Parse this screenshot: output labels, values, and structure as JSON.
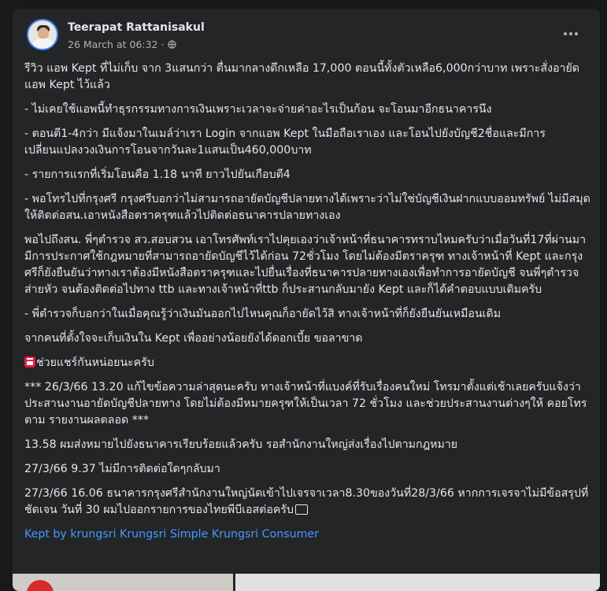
{
  "post": {
    "author": "Teerapat Rattanisakul",
    "timestamp": "26 March at 06:32",
    "separator": "·",
    "visibility_icon": "globe-icon",
    "more_icon": "more-options-icon"
  },
  "paragraphs": [
    "รีวิว แอพ Kept ที่ไม่เก็บ จาก 3แสนกว่า ตื่นมากลางดึกเหลือ 17,000 ตอนนี้ทั้งตัวเหลือ6,000กว่าบาท เพราะสั่งอายัดแอพ Kept ไว้แล้ว",
    "- ไม่เคยใช้แอพนี้ทำธุรกรรมทางการเงินเพราะเวลาจะจ่ายค่าอะไรเป็นก้อน จะโอนมาอีกธนาคารนึง",
    "- ตอนตี1-4กว่า มีแจ้งมาในเมล์ว่าเรา  Login จากแอพ Kept ในมือถือเราเอง และโอนไปยังบัญชี2ชื่อและมีการเปลี่ยนแปลงวงเงินการโอนจากวันละ1แสนเป็น460,000บาท",
    "- รายการแรกที่เริ่มโอนคือ 1.18 นาที ยาวไปยันเกือบตี4",
    "- พอโทรไปที่กรุงศรี กรุงศรีบอกว่าไม่สามารถอายัดบัญชีปลายทางได้เพราะว่าไม่ใช่บัญชีเงินฝากแบบออมทรัพย์ ไม่มีสมุด ให้ติดต่อสน.เอาหนังสือตราครุฑแล้วไปติดต่อธนาคารปลายทางเอง",
    "พอไปถึงสน. พี่ๆตำรวจ สว.สอบสวน เอาโทรศัพท์เราไปคุยเองว่าเจ้าหน้าที่ธนาคารทราบไหมครับว่าเมื่อวันที่17ที่ผ่านมามีการประกาศใช้กฎหมายที่สามารถอายัดบัญชีไว้ได้ก่อน 72ชั่วโมง โดยไม่ต้องมีตราครุฑ ทางเจ้าหน้าที่ Kept และกรุงศรีก็ยังยืนยันว่าทางเราต้องมีหนังสือตราครุฑและไปยื่นเรื่องที่ธนาคารปลายทางเองเพื่อทำการอายัดบัญชี จนพี่ๆตำรวจส่ายหัว จนต้องติดต่อไปทาง ttb และทางเจ้าหน้าที่ttb ก็ประสานกลับมายัง Kept และก็ได้คำตอบแบบเดิมครับ",
    "- พี่ตำรวจก็บอกว่าในเมื่อคุณรู้ว่าเงินมันออกไปไหนคุณก็อายัดไว้สิ ทางเจ้าหน้าที่ก็ยังยืนยันเหมือนเดิม",
    "จากคนที่ตั้งใจจะเก็บเงินใน Kept เพื่ออย่างน้อยยังได้ดอกเบี้ย ขอลาขาด",
    "ช่วยแชร์กันหน่อยนะครับ",
    "*** 26/3/66 13.20 แก้ไขข้อความล่าสุดนะครับ ทางเจ้าหน้าที่แบงค์ที่รับเรื่องคนใหม่ โทรมาตั้งแต่เช้าเลยครับแจ้งว่าประสานงานอายัดบัญชีปลายทาง โดยไม่ต้องมีหมายครุฑให้เป็นเวลา 72 ชั่วโมง และช่วยประสานงานต่างๆให้ คอยโทรตาม รายงานผลตลอด ***",
    "13.58 ผมส่งหมายไปยังธนาคารเรียบร้อยแล้วครับ รอสำนักงานใหญ่ส่งเรื่องไปตามกฎหมาย",
    "27/3/66 9.37 ไม่มีการติดต่อใดๆกลับมา",
    "27/3/66 16.06 ธนาคารกรุงศรีสำนักงานใหญ่นัดเข้าไปเจรจาเวลา8.30ของวันที่28/3/66 หากการเจรจาไม่มีข้อสรุปที่ชัดเจน วันที่ 30 ผมไปออกรายการของไทยพีบีเอสต่อครับ"
  ],
  "hashtags": [
    "Kept by krungsri",
    "Krungsri",
    "Simple",
    "Krungsri Consumer"
  ],
  "icons": {
    "calendar_emoji": "calendar-icon",
    "unsupported_emoji": "emoji-placeholder-icon"
  }
}
